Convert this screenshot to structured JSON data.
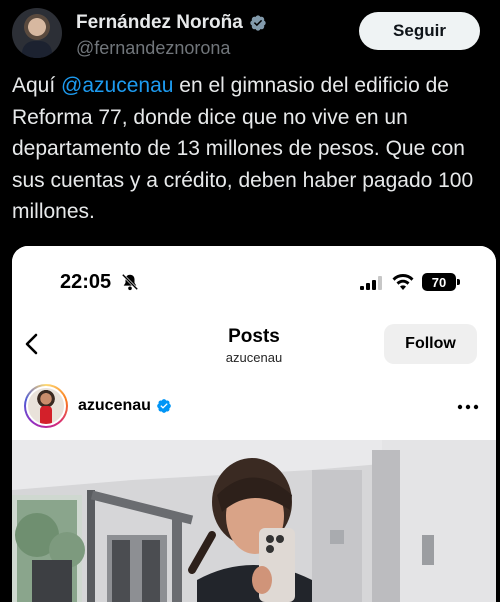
{
  "tweet": {
    "display_name": "Fernández Noroña",
    "handle": "@fernandeznorona",
    "follow_label": "Seguir",
    "text_before_mention": "Aquí ",
    "mention": "@azucenau",
    "text_after_mention": " en el gimnasio del edificio de Reforma 77, donde dice que no vive en un departamento de 13 millones de pesos. Que con sus cuentas y a crédito, deben haber pagado 100 millones.",
    "verified_icon": "verified-badge-icon",
    "colors": {
      "background": "#000000",
      "text": "#e7e9ea",
      "secondary": "#71767b",
      "mention": "#1d9bf0"
    }
  },
  "screenshot": {
    "status_bar": {
      "time": "22:05",
      "battery": "70",
      "icons": [
        "bell-off-icon",
        "signal-icon",
        "wifi-icon",
        "battery-icon"
      ]
    },
    "nav": {
      "title": "Posts",
      "subtitle": "azucenau",
      "follow_label": "Follow",
      "back_icon": "chevron-left-icon"
    },
    "post": {
      "username": "azucenau",
      "verified_icon": "ig-verified-icon",
      "more_icon": "more-dots-icon"
    }
  }
}
